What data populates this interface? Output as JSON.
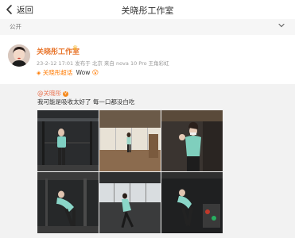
{
  "nav": {
    "back_label": "返回",
    "title": "关晓彤工作室"
  },
  "visibility": {
    "label": "公开"
  },
  "post": {
    "author": "关晓彤工作室",
    "timestamp": "23-2-12 17:01",
    "meta_rest": "发布于 北京 来自 nova 10 Pro 王角彩虹",
    "super_topic": "关晓彤超话",
    "text": "Wow"
  },
  "retweet": {
    "author": "@关晓彤",
    "text": "我可能是吸收太好了 每一口都没白吃",
    "photos": [
      {
        "name": "gym-photo-1"
      },
      {
        "name": "gym-photo-2"
      },
      {
        "name": "gym-photo-3"
      },
      {
        "name": "gym-photo-4"
      },
      {
        "name": "gym-photo-5"
      },
      {
        "name": "gym-photo-6"
      }
    ]
  },
  "colors": {
    "accent": "#eb7350",
    "author": "#e8762d",
    "super_topic": "#ff7a00"
  }
}
